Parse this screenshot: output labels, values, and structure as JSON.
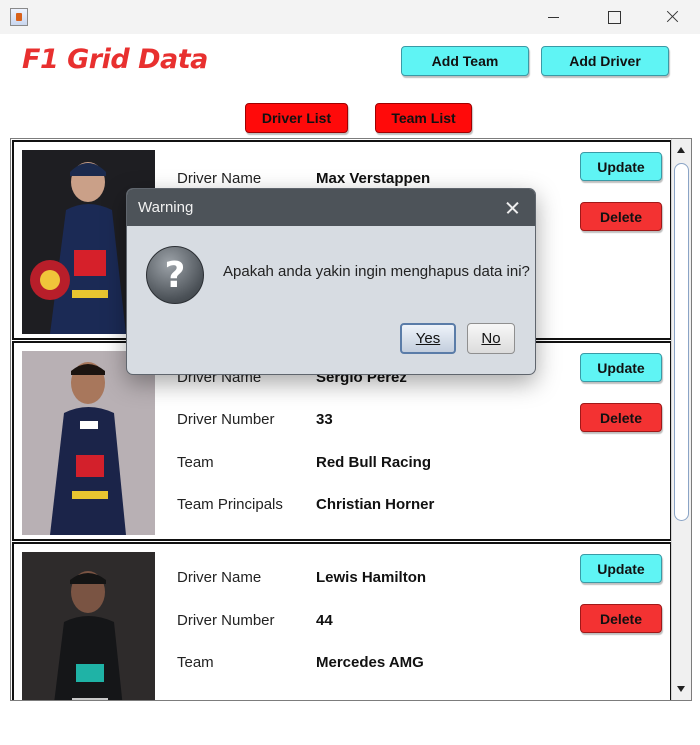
{
  "window": {
    "title": ""
  },
  "header": {
    "app_title": "F1 Grid Data",
    "add_team_label": "Add Team",
    "add_driver_label": "Add Driver",
    "driver_list_label": "Driver List",
    "team_list_label": "Team List"
  },
  "cards": [
    {
      "fields": [
        {
          "label": "Driver Name",
          "value": "Max Verstappen"
        }
      ],
      "update_label": "Update",
      "delete_label": "Delete"
    },
    {
      "fields": [
        {
          "label": "Driver Name",
          "value": "Sergio Perez"
        },
        {
          "label": "Driver Number",
          "value": "33"
        },
        {
          "label": "Team",
          "value": "Red Bull Racing"
        },
        {
          "label": "Team Principals",
          "value": "Christian Horner"
        }
      ],
      "update_label": "Update",
      "delete_label": "Delete"
    },
    {
      "fields": [
        {
          "label": "Driver Name",
          "value": "Lewis Hamilton"
        },
        {
          "label": "Driver Number",
          "value": "44"
        },
        {
          "label": "Team",
          "value": "Mercedes AMG"
        }
      ],
      "update_label": "Update",
      "delete_label": "Delete"
    }
  ],
  "dialog": {
    "title": "Warning",
    "message": "Apakah anda yakin ingin menghapus data ini?",
    "yes_label": "Yes",
    "no_label": "No",
    "icon": "question-icon"
  },
  "colors": {
    "title_red": "#e8302f",
    "button_cyan": "#5ff4f4",
    "button_red": "#f33232",
    "dialog_header": "#4d5359"
  }
}
